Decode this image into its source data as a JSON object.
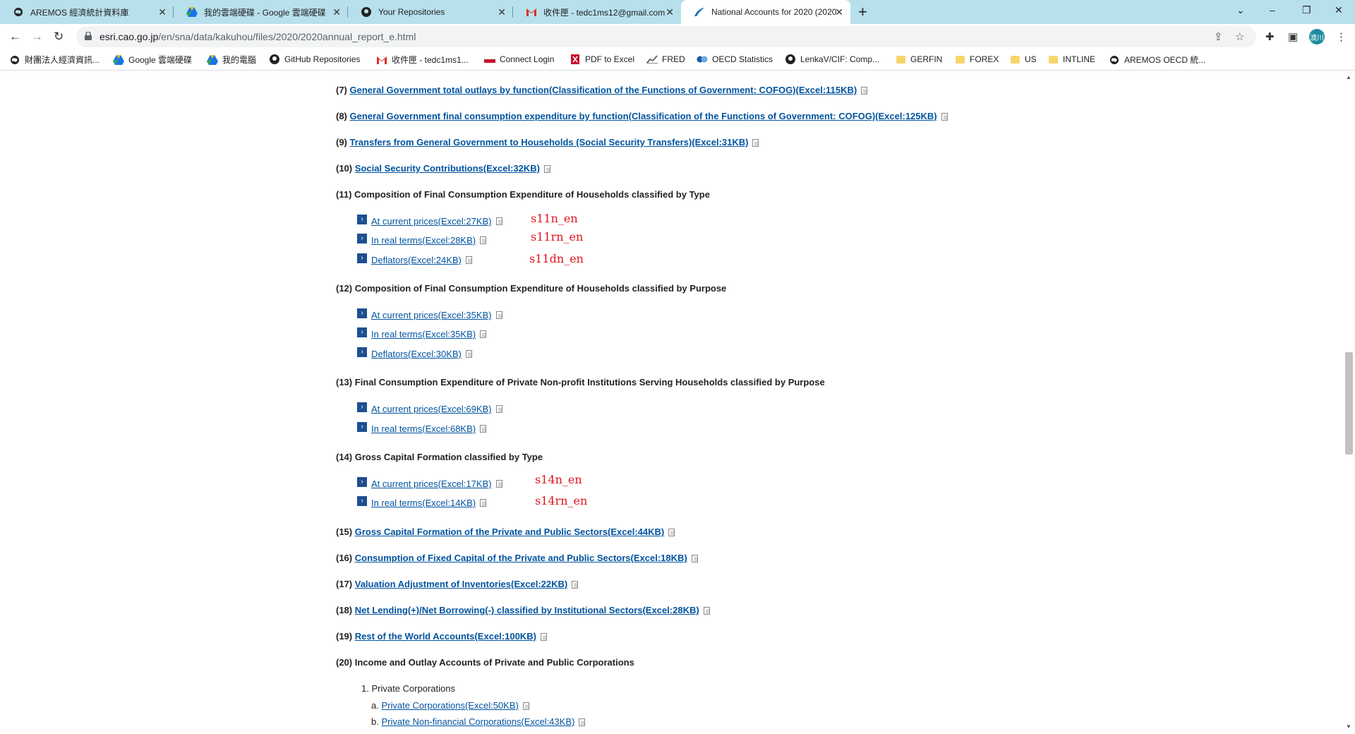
{
  "tabs": [
    {
      "label": "AREMOS 經濟統計資料庫",
      "icon": "globe-icon"
    },
    {
      "label": "我的雲端硬碟 - Google 雲端硬碟",
      "icon": "google-drive-icon"
    },
    {
      "label": "Your Repositories",
      "icon": "github-icon"
    },
    {
      "label": "收件匣 - tedc1ms12@gmail.com",
      "icon": "gmail-icon"
    },
    {
      "label": "National Accounts for 2020 (2020",
      "icon": "cabinet-office-icon"
    }
  ],
  "new_tab": "+",
  "window_controls": {
    "tab_search": "⌄",
    "minimize": "–",
    "restore": "❐",
    "close": "✕"
  },
  "nav": {
    "back": "←",
    "forward": "→",
    "reload": "↻"
  },
  "address": {
    "host": "esri.cao.go.jp",
    "path": "/en/sna/data/kakuhou/files/2020/2020annual_report_e.html"
  },
  "profile": {
    "initials": "澳川"
  },
  "bookmarks": [
    {
      "label": "財團法人經濟資訊...",
      "icon": "globe-icon"
    },
    {
      "label": "Google 雲端硬碟",
      "icon": "google-drive-icon"
    },
    {
      "label": "我的電腦",
      "icon": "google-drive-icon"
    },
    {
      "label": "GitHub Repositories",
      "icon": "github-icon"
    },
    {
      "label": "收件匣 - tedc1ms1...",
      "icon": "gmail-icon"
    },
    {
      "label": "Connect Login",
      "icon": "flag-icon"
    },
    {
      "label": "PDF to Excel",
      "icon": "pdf-excel-icon"
    },
    {
      "label": "FRED",
      "icon": "chart-icon"
    },
    {
      "label": "OECD Statistics",
      "icon": "oecd-icon"
    },
    {
      "label": "LenkaV/CIF: Comp...",
      "icon": "github-icon"
    },
    {
      "label": "GERFIN",
      "icon": "folder-icon"
    },
    {
      "label": "FOREX",
      "icon": "folder-icon"
    },
    {
      "label": "US",
      "icon": "folder-icon"
    },
    {
      "label": "INTLINE",
      "icon": "folder-icon"
    },
    {
      "label": "AREMOS OECD 統...",
      "icon": "globe-icon"
    }
  ],
  "items": [
    {
      "num": "(7)",
      "link": "General Government total outlays by function(Classification of the Functions of Government: COFOG)(Excel:115KB)"
    },
    {
      "num": "(8)",
      "link": "General Government final consumption expenditure by function(Classification of the Functions of Government: COFOG)(Excel:125KB)"
    },
    {
      "num": "(9)",
      "link": "Transfers from General Government to Households (Social Security Transfers)(Excel:31KB)"
    },
    {
      "num": "(10)",
      "link": "Social Security Contributions(Excel:32KB)"
    },
    {
      "num": "(11)",
      "text": "Composition of Final Consumption Expenditure of Households classified by Type"
    },
    {
      "num": "(12)",
      "text": "Composition of Final Consumption Expenditure of Households classified by Purpose"
    },
    {
      "num": "(13)",
      "text": "Final Consumption Expenditure of Private Non-profit Institutions Serving Households classified by Purpose"
    },
    {
      "num": "(14)",
      "text": "Gross Capital Formation classified by Type"
    },
    {
      "num": "(15)",
      "link": "Gross Capital Formation of the Private and Public Sectors(Excel:44KB)"
    },
    {
      "num": "(16)",
      "link": "Consumption of Fixed Capital of the Private and Public Sectors(Excel:18KB)"
    },
    {
      "num": "(17)",
      "link": "Valuation Adjustment of Inventories(Excel:22KB)"
    },
    {
      "num": "(18)",
      "link": "Net Lending(+)/Net Borrowing(-) classified by Institutional Sectors(Excel:28KB)"
    },
    {
      "num": "(19)",
      "link": "Rest of the World Accounts(Excel:100KB)"
    },
    {
      "num": "(20)",
      "text": "Income and Outlay Accounts of Private and Public Corporations"
    }
  ],
  "sub11": [
    "At current prices(Excel:27KB)",
    "In real terms(Excel:28KB)",
    "Deflators(Excel:24KB)"
  ],
  "sub12": [
    "At current prices(Excel:35KB)",
    "In real terms(Excel:35KB)",
    "Deflators(Excel:30KB)"
  ],
  "sub13": [
    "At current prices(Excel:69KB)",
    "In real terms(Excel:68KB)"
  ],
  "sub14": [
    "At current prices(Excel:17KB)",
    "In real terms(Excel:14KB)"
  ],
  "annotations": [
    "s11n_en",
    "s11rn_en",
    "s11dn_en",
    "s14n_en",
    "s14rn_en"
  ],
  "sub20": {
    "heading_num": "1.",
    "heading": "Private Corporations",
    "a_letter": "a.",
    "a_link": "Private Corporations(Excel:50KB)",
    "b_letter": "b.",
    "b_link": "Private Non-financial Corporations(Excel:43KB)"
  },
  "colors": {
    "link": "#00539f",
    "annotation": "#e0141e",
    "tabstrip": "#b8e0ec",
    "arrow_box": "#1d4f91"
  }
}
